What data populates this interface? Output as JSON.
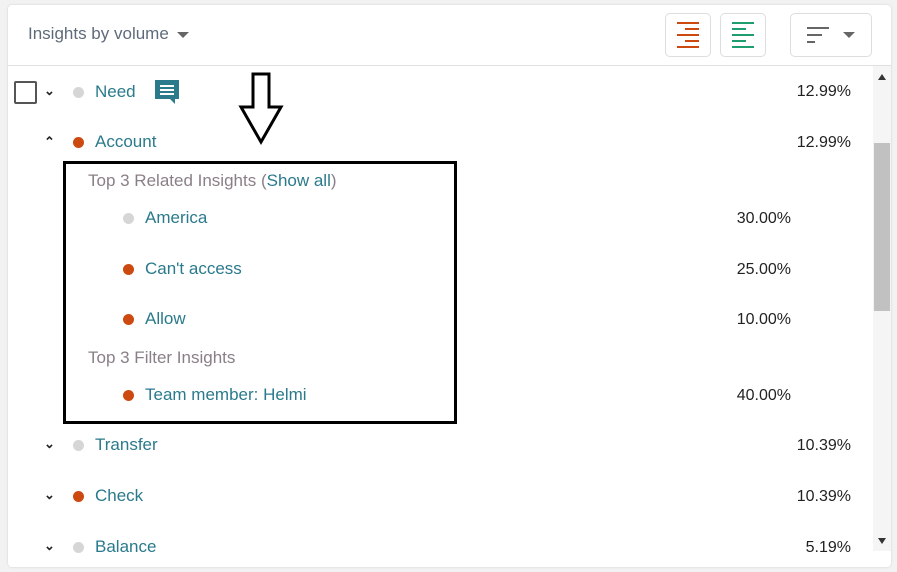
{
  "header": {
    "title": "Insights by volume",
    "buttons": [
      "align-right-icon",
      "align-left-icon",
      "sort-icon"
    ]
  },
  "colors": {
    "accent": "#2a7a8c",
    "orange": "#cc4a10",
    "green": "#1e9e6e",
    "gray_dot": "#d6d6d6"
  },
  "rows": [
    {
      "label": "Need",
      "pct": "12.99%",
      "dot": "gray",
      "chevron": "down",
      "checkbox": true,
      "comment_icon": true
    },
    {
      "label": "Account",
      "pct": "12.99%",
      "dot": "orange",
      "chevron": "up"
    },
    {
      "label": "Transfer",
      "pct": "10.39%",
      "dot": "gray",
      "chevron": "down"
    },
    {
      "label": "Check",
      "pct": "10.39%",
      "dot": "orange",
      "chevron": "down"
    },
    {
      "label": "Balance",
      "pct": "5.19%",
      "dot": "gray",
      "chevron": "down"
    }
  ],
  "expanded": {
    "related_title": "Top 3 Related Insights (",
    "show_all": "Show all",
    "related_close": ")",
    "related": [
      {
        "label": "America",
        "pct": "30.00%",
        "dot": "gray"
      },
      {
        "label": "Can't access",
        "pct": "25.00%",
        "dot": "orange"
      },
      {
        "label": "Allow",
        "pct": "10.00%",
        "dot": "orange"
      }
    ],
    "filter_title": "Top 3 Filter Insights",
    "filters": [
      {
        "label": "Team member: Helmi",
        "pct": "40.00%",
        "dot": "orange"
      }
    ]
  }
}
